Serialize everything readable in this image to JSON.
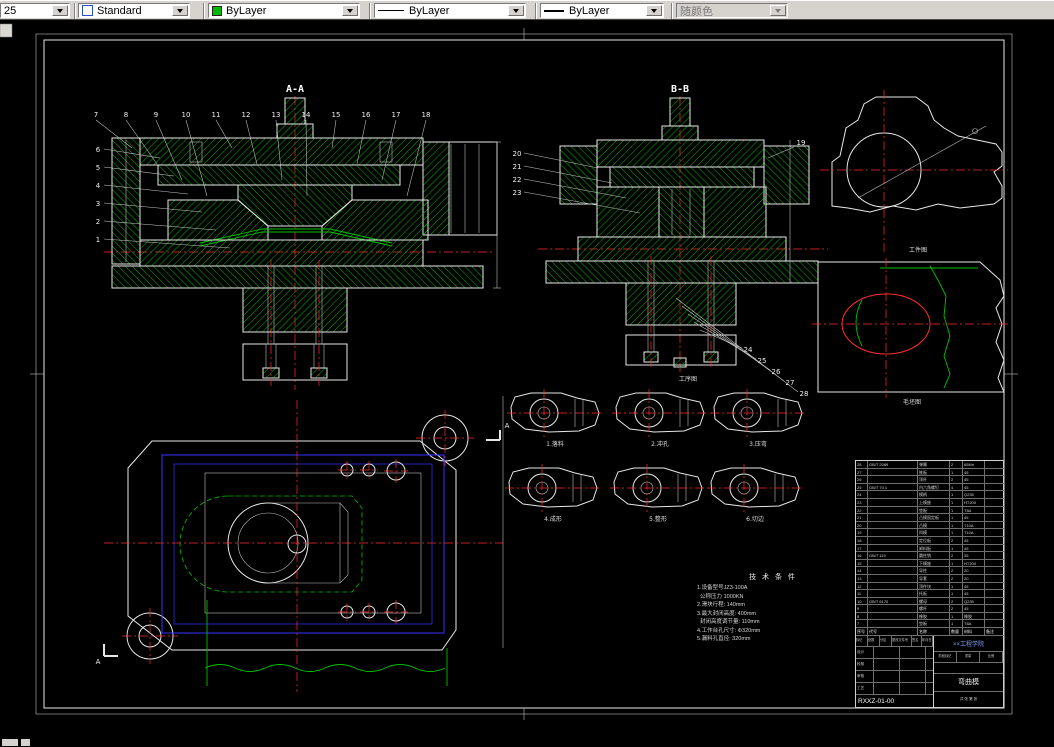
{
  "toolbar": {
    "layer_combo_value": "25",
    "text_style_value": "Standard",
    "color_value": "ByLayer",
    "color_swatch": "#00b800",
    "linetype_value": "ByLayer",
    "lineweight_value": "ByLayer",
    "plot_style_value": "随颜色"
  },
  "drawing": {
    "section_a": "A-A",
    "section_b": "B-B",
    "section_mark": "A",
    "view_label_top": "工件图",
    "view_label_bottom": "毛坯图",
    "process_title": "工序图",
    "callouts": {
      "aa_top": [
        "7",
        "8",
        "9",
        "10",
        "11",
        "12",
        "13",
        "14",
        "15",
        "16",
        "17",
        "18"
      ],
      "aa_left": [
        "6",
        "5",
        "4",
        "3",
        "2",
        "1"
      ],
      "bb_left": [
        "20",
        "21",
        "22",
        "23"
      ],
      "bb_right": [
        "19"
      ],
      "bb_bottom": [
        "24",
        "25",
        "26",
        "27",
        "28"
      ]
    },
    "colors": {
      "outline": "#e8e8e8",
      "hatch": "#00b400",
      "centerline": "#ff2a2a",
      "dieset": "#3333ff",
      "contour": "#00c000"
    }
  },
  "process_views": {
    "items": [
      "1.落料",
      "2.冲孔",
      "3.压弯",
      "4.成形",
      "5.整形",
      "6.切边"
    ]
  },
  "tech_conditions": {
    "title": "技 术 条 件",
    "lines": [
      "1.设备型号JZ3-100A",
      "  公称压力 1000KN",
      "2.滑块行程: 140mm",
      "3.最大封闭高度: 400mm",
      "  封闭高度调节量: 110mm",
      "4.工作台孔尺寸: Φ320mm",
      "5.漏料孔直径: 320mm"
    ]
  },
  "title_block": {
    "header": [
      "序号",
      "代号",
      "名称",
      "数量",
      "材料",
      "备注"
    ],
    "parts": [
      [
        "28",
        "GB/T 2089",
        "弹簧",
        "2",
        "65Mn",
        ""
      ],
      [
        "27",
        "",
        "推板",
        "1",
        "45",
        ""
      ],
      [
        "26",
        "",
        "顶杆",
        "2",
        "45",
        ""
      ],
      [
        "25",
        "GB/T 70.1",
        "内六角螺钉",
        "4",
        "45",
        ""
      ],
      [
        "24",
        "",
        "模柄",
        "1",
        "Q235",
        ""
      ],
      [
        "23",
        "",
        "上模座",
        "1",
        "HT200",
        ""
      ],
      [
        "22",
        "",
        "垫板",
        "1",
        "T8A",
        ""
      ],
      [
        "21",
        "",
        "凸模固定板",
        "1",
        "45",
        ""
      ],
      [
        "20",
        "",
        "凸模",
        "1",
        "T10A",
        ""
      ],
      [
        "19",
        "",
        "凹模",
        "1",
        "T10A",
        ""
      ],
      [
        "18",
        "",
        "定位板",
        "2",
        "45",
        ""
      ],
      [
        "17",
        "",
        "卸料板",
        "1",
        "45",
        ""
      ],
      [
        "16",
        "GB/T 119",
        "圆柱销",
        "2",
        "35",
        ""
      ],
      [
        "15",
        "",
        "下模座",
        "1",
        "HT200",
        ""
      ],
      [
        "14",
        "",
        "导柱",
        "2",
        "20",
        ""
      ],
      [
        "13",
        "",
        "导套",
        "2",
        "20",
        ""
      ],
      [
        "12",
        "",
        "顶件块",
        "1",
        "45",
        ""
      ],
      [
        "11",
        "",
        "托板",
        "1",
        "45",
        ""
      ],
      [
        "10",
        "GB/T 6170",
        "螺母",
        "2",
        "Q235",
        ""
      ],
      [
        "9",
        "",
        "螺杆",
        "2",
        "45",
        ""
      ],
      [
        "8",
        "",
        "橡胶",
        "1",
        "橡胶",
        ""
      ],
      [
        "7",
        "",
        "垫板",
        "1",
        "T8A",
        ""
      ]
    ],
    "sign_labels": [
      "标记",
      "处数",
      "分区",
      "更改文件号",
      "签名",
      "年月日"
    ],
    "role_labels": [
      "设计",
      "校核",
      "审核",
      "工艺"
    ],
    "stage_labels": [
      "阶段标记",
      "重量",
      "比例"
    ],
    "school": "××工程学院",
    "title": "弯曲模",
    "sheet": "共 张  第 张",
    "drawing_no": "RXXZ-01-00"
  }
}
